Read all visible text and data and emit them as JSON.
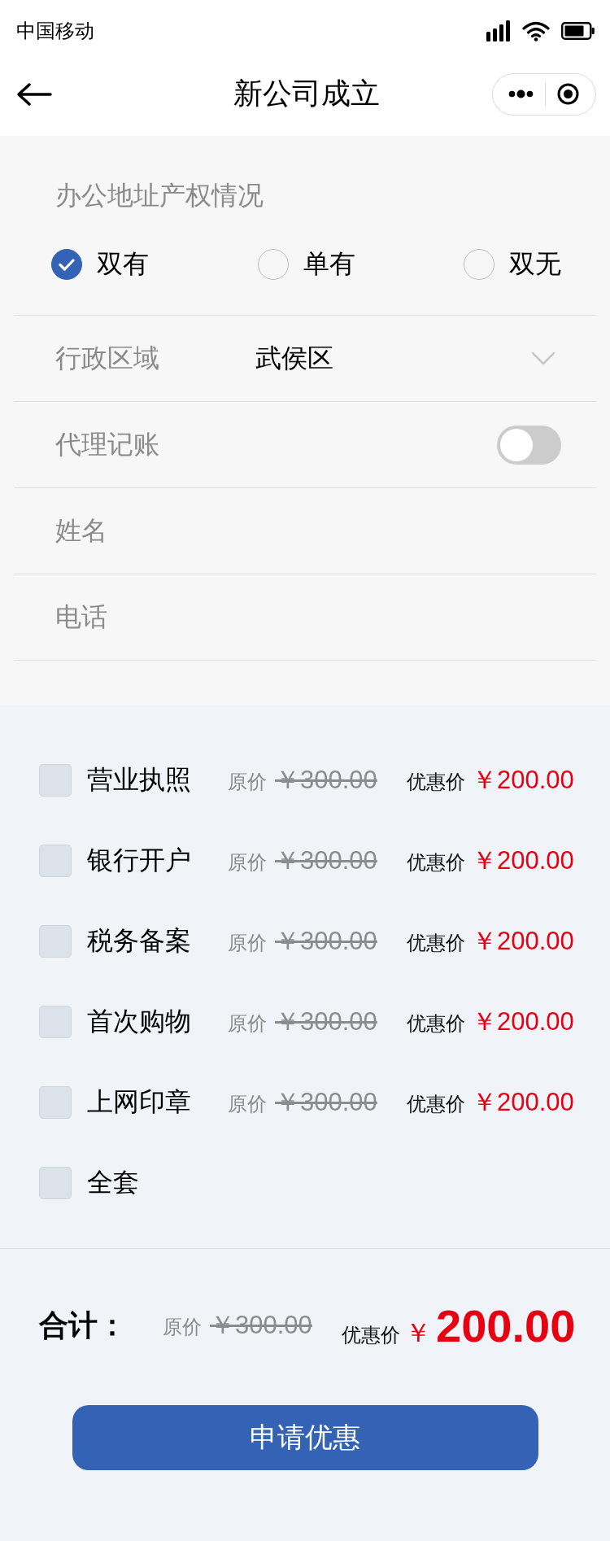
{
  "status_bar": {
    "carrier": "中国移动"
  },
  "nav_bar": {
    "title": "新公司成立"
  },
  "property_rights": {
    "label": "办公地址产权情况",
    "options": [
      {
        "label": "双有",
        "selected": true
      },
      {
        "label": "单有",
        "selected": false
      },
      {
        "label": "双无",
        "selected": false
      }
    ]
  },
  "fields": [
    {
      "kind": "select",
      "label": "行政区域",
      "value": "武侯区"
    },
    {
      "kind": "switch",
      "label": "代理记账",
      "on": false
    },
    {
      "kind": "input",
      "label": "姓名"
    },
    {
      "kind": "input",
      "label": "电话"
    }
  ],
  "services": [
    {
      "name": "营业执照",
      "checked": false,
      "original_label": "原价",
      "original_price": "￥300.00",
      "discount_label": "优惠价",
      "discount_price": "￥200.00"
    },
    {
      "name": "银行开户",
      "checked": false,
      "original_label": "原价",
      "original_price": "￥300.00",
      "discount_label": "优惠价",
      "discount_price": "￥200.00"
    },
    {
      "name": "税务备案",
      "checked": false,
      "original_label": "原价",
      "original_price": "￥300.00",
      "discount_label": "优惠价",
      "discount_price": "￥200.00"
    },
    {
      "name": "首次购物",
      "checked": false,
      "original_label": "原价",
      "original_price": "￥300.00",
      "discount_label": "优惠价",
      "discount_price": "￥200.00"
    },
    {
      "name": "上网印章",
      "checked": false,
      "original_label": "原价",
      "original_price": "￥300.00",
      "discount_label": "优惠价",
      "discount_price": "￥200.00"
    },
    {
      "name": "全套",
      "checked": false
    }
  ],
  "total": {
    "label": "合计：",
    "original_label": "原价",
    "original_price": "￥300.00",
    "discount_label": "优惠价",
    "currency": "￥",
    "discount_price": "200.00"
  },
  "submit_button": {
    "label": "申请优惠"
  }
}
